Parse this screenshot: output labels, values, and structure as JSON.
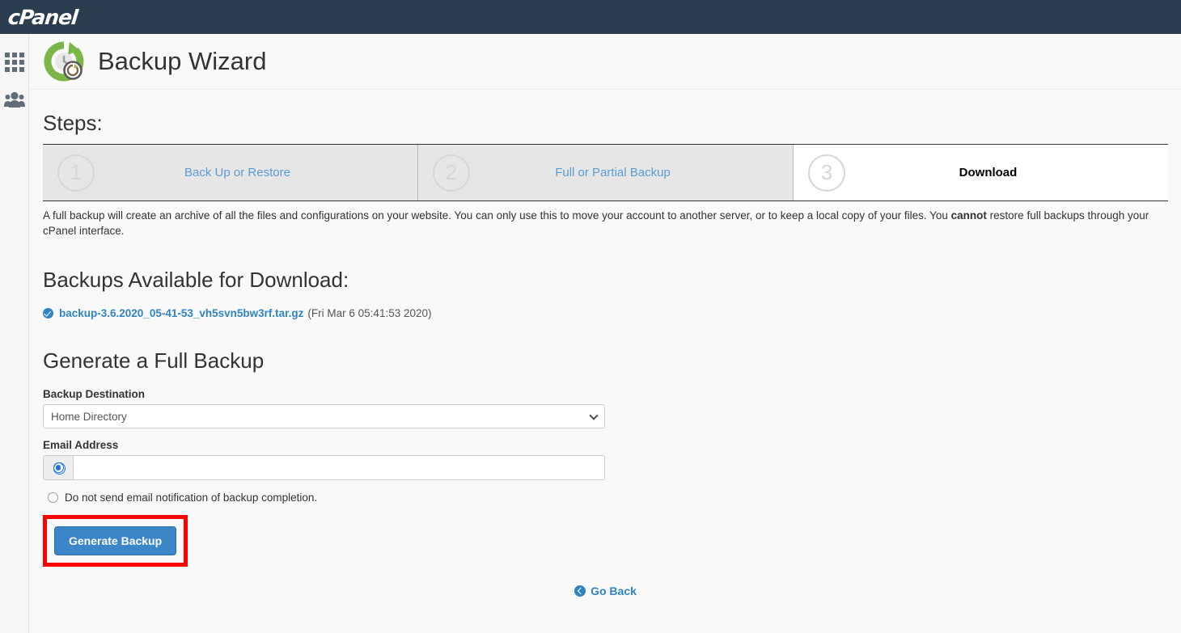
{
  "navbar": {
    "brand": "cPanel"
  },
  "sidebar": {
    "items": [
      {
        "name": "apps-grid-icon",
        "label": "Apps"
      },
      {
        "name": "users-icon",
        "label": "User Manager"
      }
    ]
  },
  "header": {
    "title": "Backup Wizard",
    "icon": "backup-wizard-icon"
  },
  "steps": {
    "heading": "Steps:",
    "items": [
      {
        "number": "1",
        "label": "Back Up or Restore",
        "active": false
      },
      {
        "number": "2",
        "label": "Full or Partial Backup",
        "active": false
      },
      {
        "number": "3",
        "label": "Download",
        "active": true
      }
    ]
  },
  "description": {
    "part1": "A full backup will create an archive of all the files and configurations on your website. You can only use this to move your account to another server, or to keep a local copy of your files. You ",
    "emphasis": "cannot",
    "part2": " restore full backups through your cPanel interface."
  },
  "downloads": {
    "title": "Backups Available for Download:",
    "items": [
      {
        "filename": "backup-3.6.2020_05-41-53_vh5svn5bw3rf.tar.gz",
        "date": "(Fri Mar 6 05:41:53 2020)"
      }
    ]
  },
  "generate": {
    "title": "Generate a Full Backup",
    "destination_label": "Backup Destination",
    "destination_value": "Home Directory",
    "destination_options": [
      "Home Directory"
    ],
    "email_label": "Email Address",
    "email_value": "",
    "email_placeholder": "",
    "no_email_label": "Do not send email notification of backup completion.",
    "submit_label": "Generate Backup"
  },
  "footer": {
    "go_back_label": "Go Back"
  },
  "colors": {
    "navbar": "#2b3e50",
    "accent_blue": "#2f83c5",
    "button_blue": "#3b86c8",
    "annotation_red": "#ff0000",
    "step_inactive_bg": "#e6e6e6",
    "icon_green": "#7ab648"
  }
}
